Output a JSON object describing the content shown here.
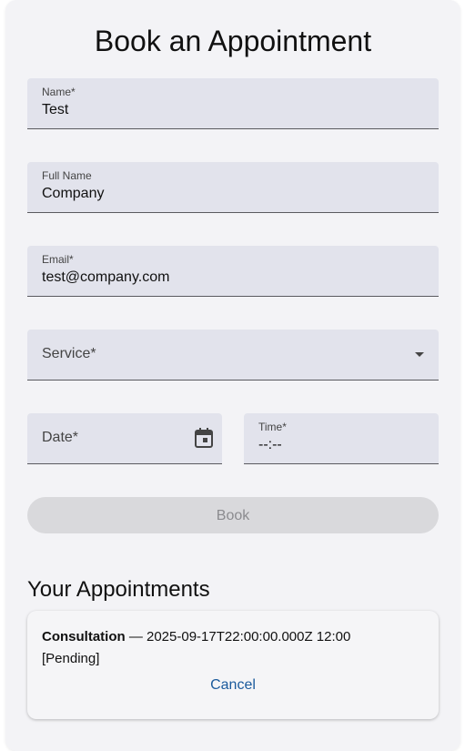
{
  "page": {
    "title": "Book an Appointment"
  },
  "form": {
    "name": {
      "label": "Name*",
      "value": "Test"
    },
    "full_name": {
      "label": "Full Name",
      "value": "Company"
    },
    "email": {
      "label": "Email*",
      "value": "test@company.com"
    },
    "service": {
      "label": "Service*",
      "value": ""
    },
    "date": {
      "label": "Date*",
      "value": ""
    },
    "time": {
      "label": "Time*",
      "value": "--:--"
    },
    "book_label": "Book"
  },
  "appointments": {
    "title": "Your Appointments",
    "items": [
      {
        "service": "Consultation",
        "separator": " — ",
        "datetime": "2025-09-17T22:00:00.000Z 12:00",
        "status": "[Pending]",
        "cancel_label": "Cancel"
      }
    ]
  },
  "colors": {
    "field_bg": "#e2e3ec",
    "card_bg": "#f3f3f6",
    "link": "#1a5a9c",
    "button_disabled": "#d9d9dc"
  },
  "icons": {
    "service_dropdown": "arrow-drop-down-icon",
    "date_picker": "calendar-icon"
  }
}
